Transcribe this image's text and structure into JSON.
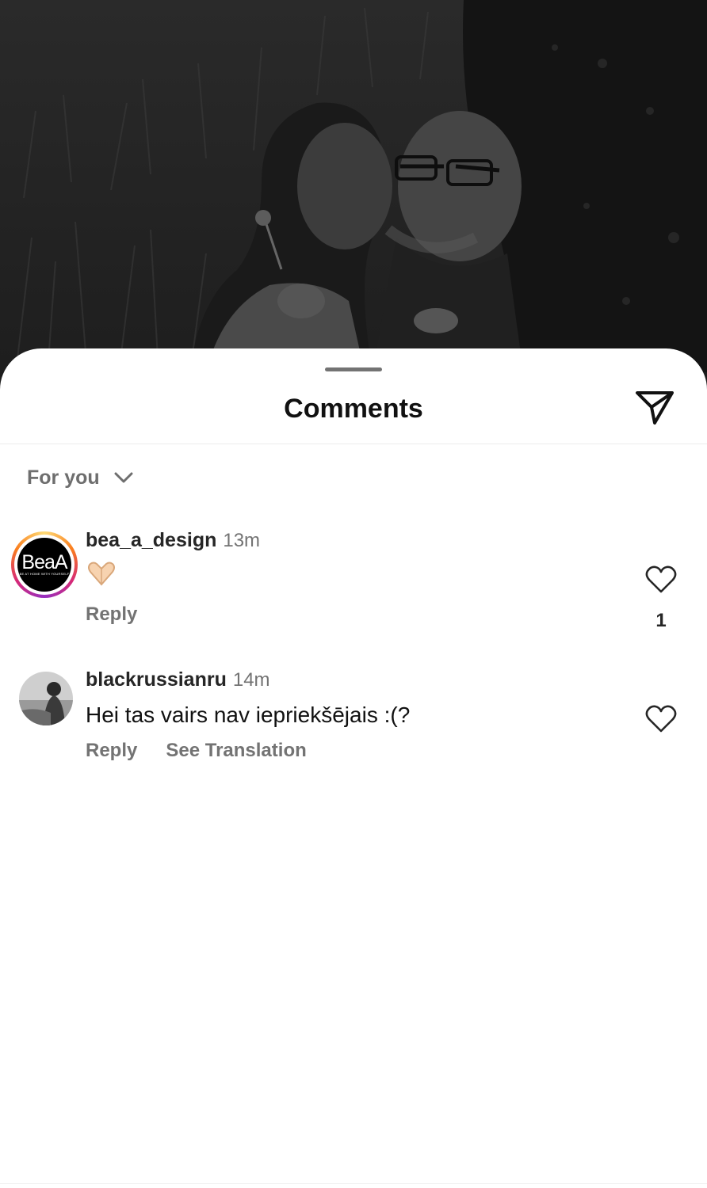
{
  "sheet": {
    "title": "Comments",
    "sort_label": "For you"
  },
  "icons": {
    "share": "paper-plane-icon",
    "sort": "chevron-down-icon",
    "like": "heart-icon"
  },
  "comments": [
    {
      "username": "bea_a_design",
      "time": "13m",
      "text": "🫶🏻",
      "avatar_text": "BeaA",
      "avatar_tagline": "BE AT HOME WITH YOURSELF",
      "actions": [
        "Reply"
      ],
      "likes": "1"
    },
    {
      "username": "blackrussianru",
      "time": "14m",
      "text": "Hei tas vairs nav iepriekšējais :(?",
      "actions": [
        "Reply",
        "See Translation"
      ],
      "likes": null
    }
  ],
  "colors": {
    "text_primary": "#111111",
    "text_secondary": "#737373",
    "story_ring": [
      "#feda75",
      "#fa7e1e",
      "#d62976",
      "#962fbf"
    ]
  }
}
